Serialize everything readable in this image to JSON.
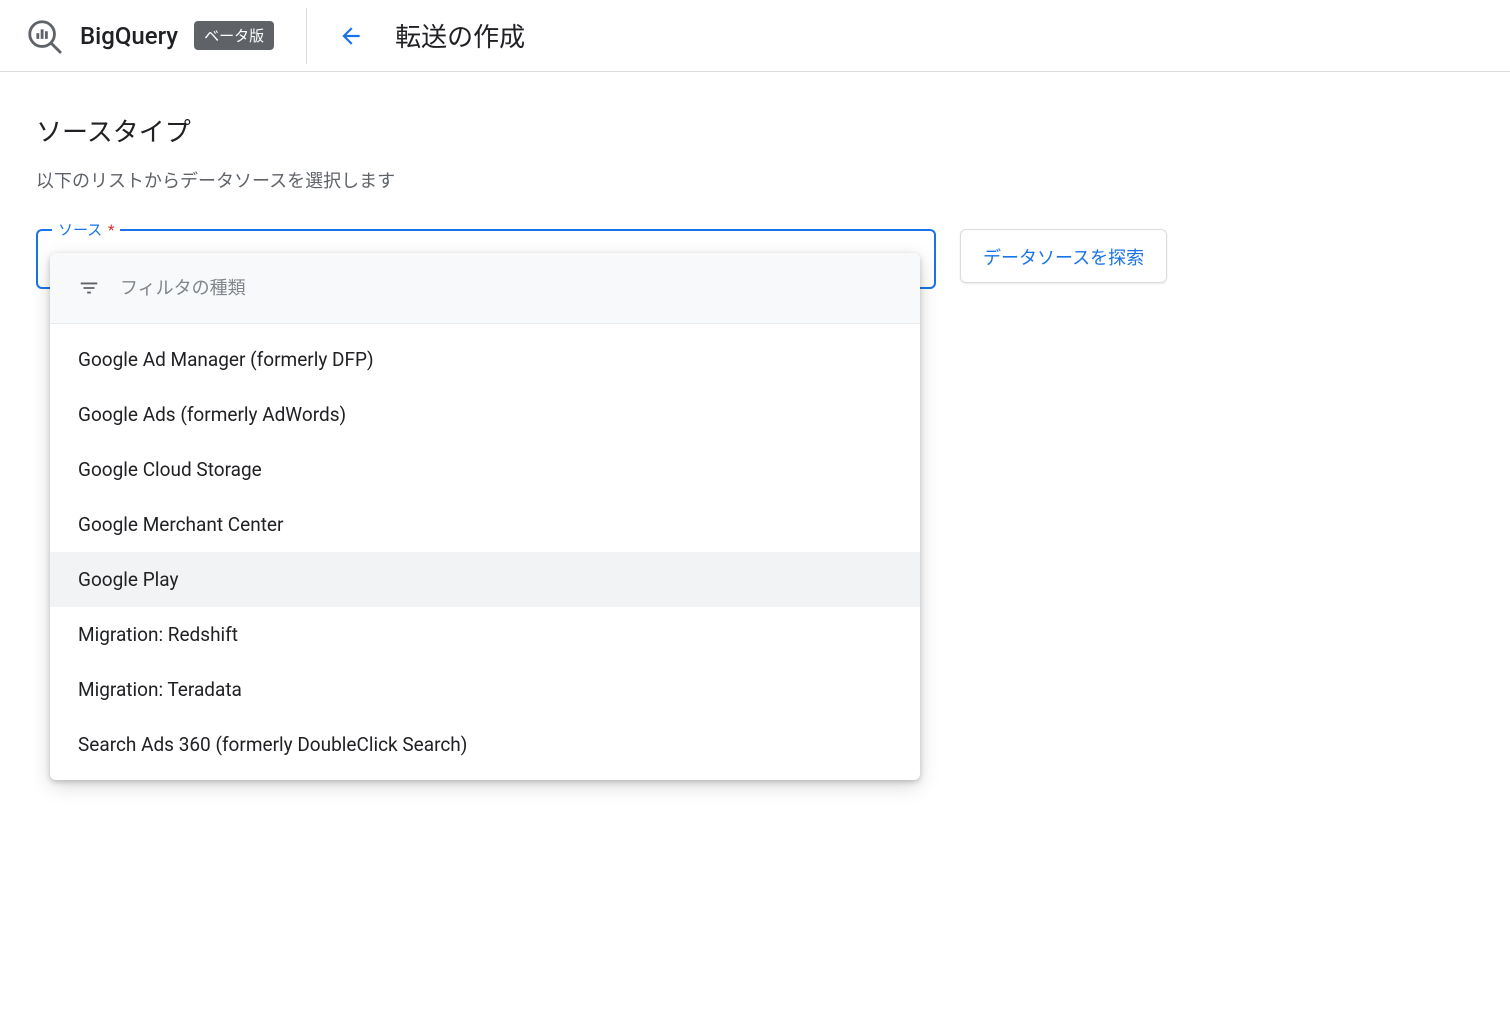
{
  "header": {
    "product_name": "BigQuery",
    "beta_badge": "ベータ版",
    "page_title": "転送の作成"
  },
  "section": {
    "title": "ソースタイプ",
    "subtitle": "以下のリストからデータソースを選択します"
  },
  "source_select": {
    "label": "ソース",
    "required_mark": "*",
    "filter_placeholder": "フィルタの種類",
    "options": [
      "Google Ad Manager (formerly DFP)",
      "Google Ads (formerly AdWords)",
      "Google Cloud Storage",
      "Google Merchant Center",
      "Google Play",
      "Migration: Redshift",
      "Migration: Teradata",
      "Search Ads 360 (formerly DoubleClick Search)"
    ],
    "highlighted_index": 4
  },
  "explore_button_label": "データソースを探索"
}
